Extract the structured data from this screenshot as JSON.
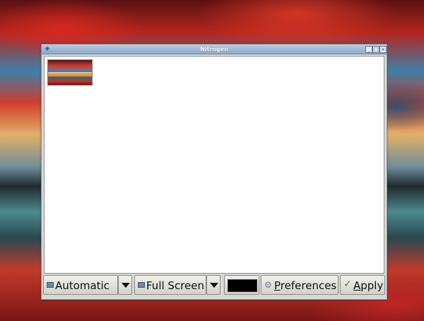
{
  "window": {
    "title": "Nitrogen"
  },
  "content": {
    "wallpapers": [
      {
        "icon": "wallpaper-thumbnail"
      }
    ]
  },
  "toolbar": {
    "mode_combo_label": "Automatic",
    "display_combo_label": "Full Screen",
    "preferences_mnemonic": "P",
    "preferences_rest": "references",
    "apply_mnemonic": "A",
    "apply_rest": "pply",
    "background_color": "#000000"
  },
  "colors": {
    "titlebar": "#8ba9c8",
    "apply_icon": "#2f9a29"
  }
}
